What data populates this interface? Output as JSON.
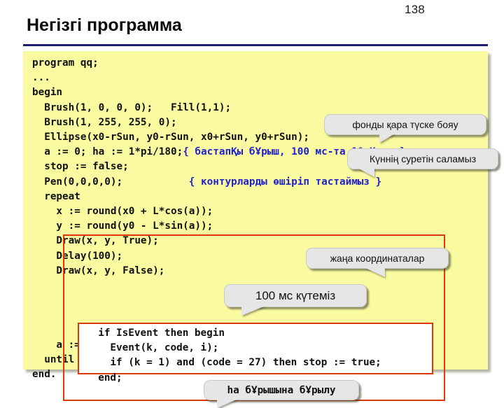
{
  "header": {
    "page_number": "138",
    "title": "Негізгі программа",
    "rule_color": "#1c1c70"
  },
  "code_panel": {
    "background_color": "#fafaa0",
    "comment_color": "#2222cc",
    "code": "program qq;\n...\nbegin\n  Brush(1, 0, 0, 0);   Fill(1,1);\n  Brush(1, 255, 255, 0);\n  Ellipse(x0-rSun, y0-rSun, x0+rSun, y0+rSun);\n  a := 0; ha := 1*pi/180;",
    "comment_1": "{ бастапҚы бҰрыш, 100 мс-та 1° Қадам}",
    "code_2": "  stop := false;\n  Pen(0,0,0,0);           ",
    "comment_2": "{ контурларды өшіріп тастаймыз }",
    "code_3": "  repeat\n    x := round(x0 + L*cos(a));\n    y := round(y0 - L*sin(a));\n    Draw(x, y, True);\n    Delay(100);\n    Draw(x, y, False);",
    "code_4": "    a := a + ha;\n  until stop;\nend.",
    "inner_box_code": "  if IsEvent then begin\n    Event(k, code, i);\n    if (k = 1) and (code = 27) then stop := true;\n  end;",
    "box_border_color": "#d93a06"
  },
  "callouts": {
    "fill_background": "фонды қара түске бояу",
    "draw_sun": "Күннің суретін саламыз",
    "new_coordinates": "жаңа координаталар",
    "delay": "100 мс күтеміз",
    "turn_angle": "ha бҰрышына бҰрылу"
  }
}
